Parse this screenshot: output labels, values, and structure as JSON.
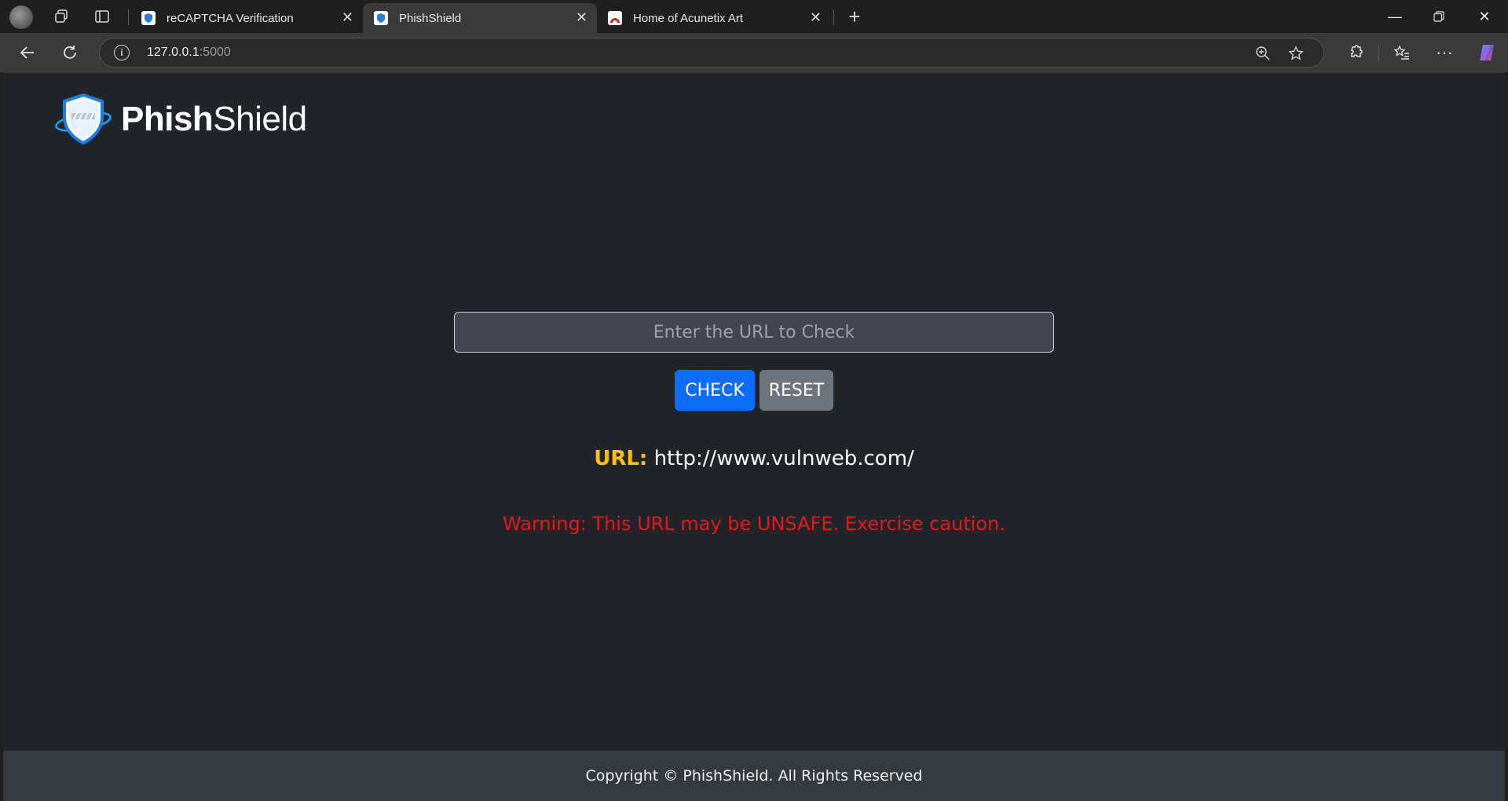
{
  "browser": {
    "tabs": [
      {
        "title": "reCAPTCHA Verification",
        "icon": "shield-favicon-icon",
        "active": false
      },
      {
        "title": "PhishShield",
        "icon": "shield-favicon-icon",
        "active": true
      },
      {
        "title": "Home of Acunetix Art",
        "icon": "acunetix-favicon-icon",
        "active": false
      }
    ],
    "address": {
      "host": "127.0.0.1",
      "port": ":5000"
    }
  },
  "page": {
    "logo": {
      "bold": "Phish",
      "regular": "Shield"
    },
    "input": {
      "placeholder": "Enter the URL to Check",
      "value": ""
    },
    "buttons": {
      "check": "CHECK",
      "reset": "RESET"
    },
    "result": {
      "label": "URL:",
      "url": "http://www.vulnweb.com/"
    },
    "warning": "Warning: This URL may be UNSAFE. Exercise caution.",
    "footer": "Copyright © PhishShield. All Rights Reserved"
  },
  "colors": {
    "page_bg": "#212529",
    "footer_bg": "#343a40",
    "check_button": "#0d6efd",
    "reset_button": "#6c757d",
    "url_label": "#ffc107",
    "warning": "#e8161c"
  }
}
